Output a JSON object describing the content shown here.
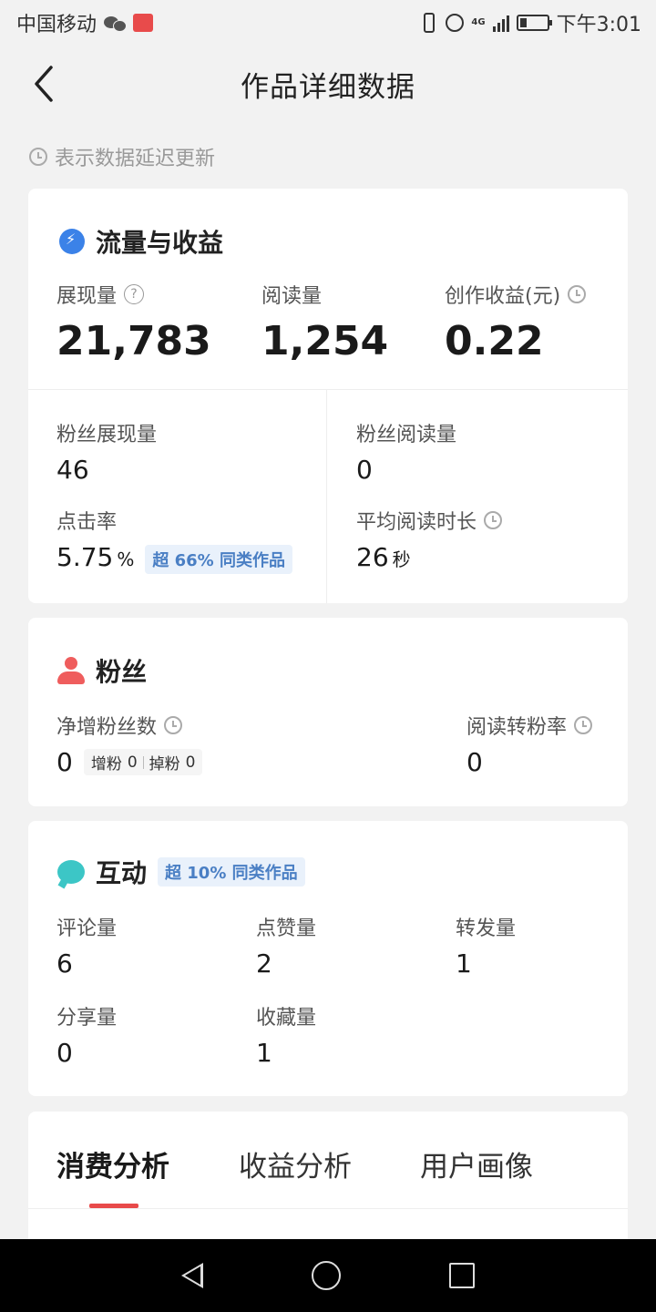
{
  "status_bar": {
    "carrier": "中国移动",
    "time": "下午3:01",
    "network": "4G"
  },
  "header": {
    "title": "作品详细数据"
  },
  "delay_note": "表示数据延迟更新",
  "traffic": {
    "title": "流量与收益",
    "impressions": {
      "label": "展现量",
      "value": "21,783"
    },
    "reads": {
      "label": "阅读量",
      "value": "1,254"
    },
    "earnings": {
      "label": "创作收益(元)",
      "value": "0.22"
    },
    "fan_impressions": {
      "label": "粉丝展现量",
      "value": "46"
    },
    "fan_reads": {
      "label": "粉丝阅读量",
      "value": "0"
    },
    "ctr": {
      "label": "点击率",
      "value": "5.75",
      "unit": "%",
      "badge": "超 66% 同类作品"
    },
    "avg_read_time": {
      "label": "平均阅读时长",
      "value": "26",
      "unit": "秒"
    }
  },
  "fans": {
    "title": "粉丝",
    "net_growth": {
      "label": "净增粉丝数",
      "value": "0",
      "gain_label": "增粉",
      "gain_value": "0",
      "loss_label": "掉粉",
      "loss_value": "0"
    },
    "conversion": {
      "label": "阅读转粉率",
      "value": "0"
    }
  },
  "interaction": {
    "title": "互动",
    "badge": "超 10% 同类作品",
    "comments": {
      "label": "评论量",
      "value": "6"
    },
    "likes": {
      "label": "点赞量",
      "value": "2"
    },
    "forwards": {
      "label": "转发量",
      "value": "1"
    },
    "shares": {
      "label": "分享量",
      "value": "0"
    },
    "favorites": {
      "label": "收藏量",
      "value": "1"
    }
  },
  "tabs": [
    {
      "label": "消费分析",
      "active": true
    },
    {
      "label": "收益分析",
      "active": false
    },
    {
      "label": "用户画像",
      "active": false
    }
  ],
  "colors": {
    "accent_red": "#e84a4a",
    "badge_bg": "#e9f1fb",
    "badge_text": "#4a7fc4",
    "traffic_icon": "#3b82e8",
    "fans_icon": "#ef5d5d",
    "interaction_icon": "#3cc6c6"
  }
}
